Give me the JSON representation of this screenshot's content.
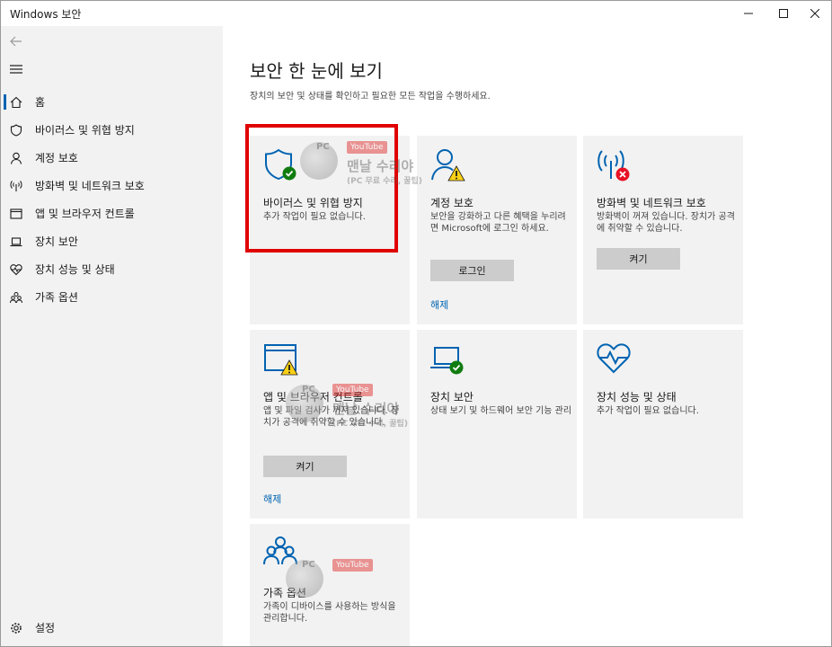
{
  "window": {
    "title": "Windows 보안"
  },
  "sidebar": {
    "items": [
      {
        "label": "홈",
        "icon": "home-icon"
      },
      {
        "label": "바이러스 및 위협 방지",
        "icon": "shield-icon"
      },
      {
        "label": "계정 보호",
        "icon": "person-icon"
      },
      {
        "label": "방화벽 및 네트워크 보호",
        "icon": "antenna-icon"
      },
      {
        "label": "앱 및 브라우저 컨트롤",
        "icon": "browser-window-icon"
      },
      {
        "label": "장치 보안",
        "icon": "laptop-icon"
      },
      {
        "label": "장치 성능 및 상태",
        "icon": "heart-pulse-icon"
      },
      {
        "label": "가족 옵션",
        "icon": "family-icon"
      }
    ],
    "settings_label": "설정"
  },
  "main": {
    "title": "보안 한 눈에 보기",
    "subtitle": "장치의 보안 및 상태를 확인하고 필요한 모든 작업을 수행하세요."
  },
  "tiles": {
    "virus": {
      "title": "바이러스 및 위협 방지",
      "desc": "추가 작업이 필요 없습니다.",
      "status": "ok"
    },
    "account": {
      "title": "계정 보호",
      "desc": "보안을 강화하고 다른 혜택을 누리려면 Microsoft에 로그인 하세요.",
      "button": "로그인",
      "link": "해제",
      "status": "warning"
    },
    "firewall": {
      "title": "방화벽 및 네트워크 보호",
      "desc": "방화벽이 꺼져 있습니다. 장치가 공격에 취약할 수 있습니다.",
      "button": "켜기",
      "status": "error"
    },
    "appbrowser": {
      "title": "앱 및 브라우저 컨트롤",
      "desc": "앱 및 파일 검사가 꺼져 있습니다. 장치가 공격에 취약할 수 있습니다.",
      "button": "켜기",
      "link": "해제",
      "status": "warning"
    },
    "device": {
      "title": "장치 보안",
      "desc": "상태 보기 및 하드웨어 보안 기능 관리",
      "status": "ok"
    },
    "performance": {
      "title": "장치 성능 및 상태",
      "desc": "추가 작업이 필요 없습니다.",
      "status": "none"
    },
    "family": {
      "title": "가족 옵션",
      "desc": "가족이 디바이스를 사용하는 방식을 관리합니다.",
      "status": "none"
    }
  },
  "watermark": {
    "logo_text": "PC",
    "badge": "YouTube",
    "main": "맨날 수리야",
    "sub": "(PC 무료 수리, 꿀팁)"
  },
  "colors": {
    "accent": "#0063b1",
    "icon_blue": "#0063b1",
    "ok_green": "#107c10",
    "warning_yellow": "#fcd116",
    "error_red": "#e81123",
    "highlight_red": "#e00000",
    "tile_bg": "#f2f2f2",
    "sidebar_bg": "#f2f2f2"
  }
}
